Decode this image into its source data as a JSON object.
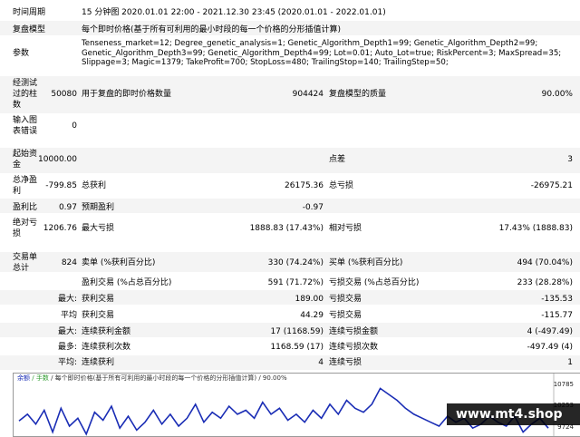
{
  "labels": {
    "period": "时间周期",
    "model": "复盘模型",
    "params": "参数",
    "bars1": "经测试",
    "bars2": "过的柱",
    "bars3": "数",
    "err1": "输入图",
    "err2": "表错误",
    "dep1": "起始资",
    "dep2": "金",
    "net1": "总净盈",
    "net2": "利",
    "pf": "盈利比",
    "abs1": "绝对亏",
    "abs2": "损",
    "trades1": "交易单",
    "trades2": "总计"
  },
  "period_value": "15 分钟图 2020.01.01 22:00 - 2021.12.30 23:45 (2020.01.01 - 2022.01.01)",
  "model_value": "每个即时价格(基于所有可利用的最小时段的每一个价格的分形插值计算)",
  "params_value": "Tenseness_market=12; Degree_genetic_analysis=1; Genetic_Algorithm_Depth1=99; Genetic_Algorithm_Depth2=99; Genetic_Algorithm_Depth3=99; Genetic_Algorithm_Depth4=99; Lot=0.01; Auto_Lot=true; RiskPercent=3; MaxSpread=35; Slippage=3; Magic=1379; TakeProfit=700; StopLoss=480; TrailingStop=140; TrailingStep=50;",
  "stats": {
    "bars_tested": "50080",
    "ticks_label": "用于复盘的即时价格数量",
    "ticks": "904424",
    "quality_label": "复盘模型的质量",
    "quality": "90.00%",
    "errors": "0",
    "deposit": "10000.00",
    "spread_label": "点差",
    "spread": "3",
    "net_profit": "-799.85",
    "gross_profit_label": "总获利",
    "gross_profit": "26175.36",
    "gross_loss_label": "总亏损",
    "gross_loss": "-26975.21",
    "profit_factor": "0.97",
    "expected_payoff_label": "预期盈利",
    "expected_payoff": "-0.97",
    "abs_drawdown": "1206.76",
    "max_drawdown_label": "最大亏损",
    "max_drawdown": "1888.83 (17.43%)",
    "rel_drawdown_label": "相对亏损",
    "rel_drawdown": "17.43% (1888.83)",
    "total_trades": "824",
    "short_label": "卖单 (%获利百分比)",
    "short": "330 (74.24%)",
    "long_label": "买单 (%获利百分比)",
    "long": "494 (70.04%)",
    "won_label": "盈利交易 (%占总百分比)",
    "won": "591 (71.72%)",
    "lost_label": "亏损交易 (%占总百分比)",
    "lost": "233 (28.28%)",
    "largest_prefix": "最大:",
    "largest_profit_label": "获利交易",
    "largest_profit": "189.00",
    "largest_loss_label": "亏损交易",
    "largest_loss": "-135.53",
    "average_prefix": "平均",
    "avg_profit_label": "获利交易",
    "avg_profit": "44.29",
    "avg_loss_label": "亏损交易",
    "avg_loss": "-115.77",
    "max_prefix": "最大:",
    "max_consec_wins_label": "连续获利金额",
    "max_consec_wins": "17 (1168.59)",
    "max_consec_losses_label": "连续亏损金额",
    "max_consec_losses": "4 (-497.49)",
    "maximal_prefix": "最多:",
    "max_consec_profit_label": "连续获利次数",
    "max_consec_profit": "1168.59 (17)",
    "max_consec_loss_label": "连续亏损次数",
    "max_consec_loss": "-497.49 (4)",
    "avg_consec_prefix": "平均:",
    "avg_consec_wins_label": "连续获利",
    "avg_consec_wins": "4",
    "avg_consec_losses_label": "连续亏损",
    "avg_consec_losses": "1"
  },
  "chart": {
    "legend_balance": "余额",
    "legend_lot": "/ 手数",
    "legend_text": "/ 每个即时价格(基于所有可利用的最小时段的每一个价格的分形插值计算) / 90.00%",
    "colors": {
      "balance": "#1a2db5",
      "lot": "#2e9b2e"
    }
  },
  "chart_data": {
    "type": "line",
    "ylim": [
      9600,
      10900
    ],
    "yticks": [
      "10785",
      "10253",
      "9724"
    ],
    "series": [
      {
        "values": [
          9980,
          10150,
          9900,
          10250,
          9700,
          10300,
          9850,
          10050,
          9650,
          10200,
          10000,
          10350,
          9800,
          10100,
          9750,
          9950,
          10250,
          9900,
          10150,
          9850,
          10050,
          10400,
          9950,
          10200,
          10050,
          10350,
          10150,
          10250,
          10050,
          10450,
          10150,
          10300,
          10000,
          10150,
          9950,
          10250,
          10050,
          10400,
          10150,
          10500,
          10300,
          10200,
          10400,
          10800,
          10650,
          10500,
          10300,
          10150,
          10050,
          9950,
          9850,
          10100,
          9950,
          10050,
          9800,
          9900,
          10100,
          9950,
          9850,
          10100,
          9700,
          9900,
          10050,
          9800
        ]
      }
    ]
  },
  "banner": "www.mt4.shop"
}
